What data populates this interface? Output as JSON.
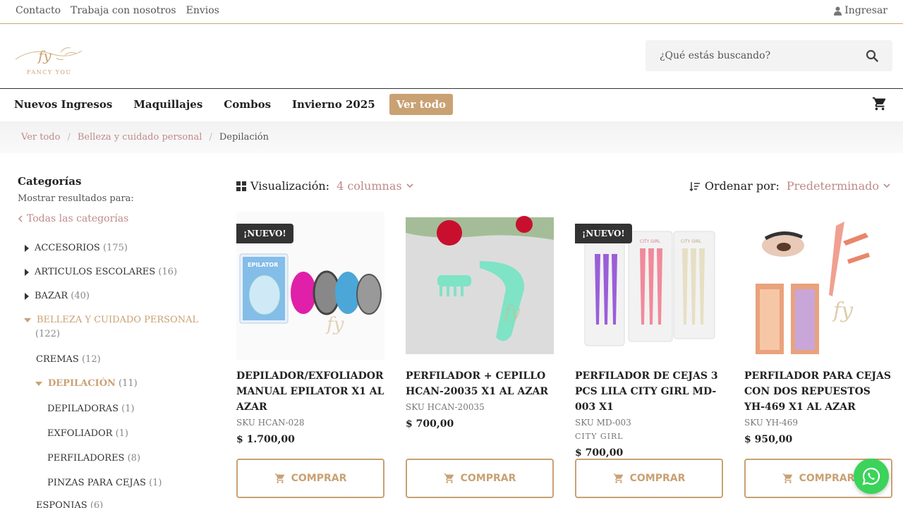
{
  "topbar": {
    "links": [
      "Contacto",
      "Trabaja con nosotros",
      "Envios"
    ],
    "login": "Ingresar"
  },
  "logo": {
    "initials": "fy",
    "text": "FANCY YOU"
  },
  "search": {
    "placeholder": "¿Qué estás buscando?"
  },
  "nav": {
    "items": [
      "Nuevos Ingresos",
      "Maquillajes",
      "Combos",
      "Invierno 2025"
    ],
    "cta": "Ver todo"
  },
  "breadcrumb": [
    "Ver todo",
    "Belleza y cuidado personal",
    "Depilación"
  ],
  "sidebar": {
    "title": "Categorías",
    "subtitle": "Mostrar resultados para:",
    "all": "Todas las categorías",
    "categories": [
      {
        "label": "ACCESORIOS",
        "count": "(175)"
      },
      {
        "label": "ARTICULOS ESCOLARES",
        "count": "(16)"
      },
      {
        "label": "BAZAR",
        "count": "(40)"
      },
      {
        "label": "BELLEZA Y CUIDADO PERSONAL",
        "count": "(122)"
      },
      {
        "label": "CREMAS",
        "count": "(12)"
      },
      {
        "label": "DEPILACIÓN",
        "count": "(11)"
      },
      {
        "label": "DEPILADORAS",
        "count": "(1)"
      },
      {
        "label": "EXFOLIADOR",
        "count": "(1)"
      },
      {
        "label": "PERFILADORES",
        "count": "(8)"
      },
      {
        "label": "PINZAS PARA CEJAS",
        "count": "(1)"
      },
      {
        "label": "ESPONJAS",
        "count": "(6)"
      }
    ]
  },
  "toolbar": {
    "view_label": "Visualización:",
    "view_value": "4 columnas",
    "sort_label": "Ordenar por:",
    "sort_value": "Predeterminado"
  },
  "products": [
    {
      "badge": "¡NUEVO!",
      "name": "DEPILADOR/EXFOLIADOR MANUAL EPILATOR X1 AL AZAR",
      "sku": "SKU HCAN-028",
      "brand": "",
      "price": "$  1.700,00",
      "img_text": "EPILATOR"
    },
    {
      "badge": "",
      "name": "PERFILADOR + CEPILLO HCAN-20035 X1 AL AZAR",
      "sku": "SKU HCAN-20035",
      "brand": "",
      "price": "$  700,00"
    },
    {
      "badge": "¡NUEVO!",
      "name": "PERFILADOR DE CEJAS 3 PCS LILA CITY GIRL MD-003 X1",
      "sku": "SKU MD-003",
      "brand": "CITY GIRL",
      "price": "$  700,00",
      "img_text": "CITY GIRL"
    },
    {
      "badge": "",
      "name": "PERFILADOR PARA CEJAS CON DOS REPUESTOS YH-469 X1 AL AZAR",
      "sku": "SKU YH-469",
      "brand": "",
      "price": "$  950,00"
    }
  ],
  "buy_label": "COMPRAR",
  "colors": {
    "gold": "#c9a173",
    "rose": "#c08a8a",
    "whatsapp": "#3bd35a"
  }
}
